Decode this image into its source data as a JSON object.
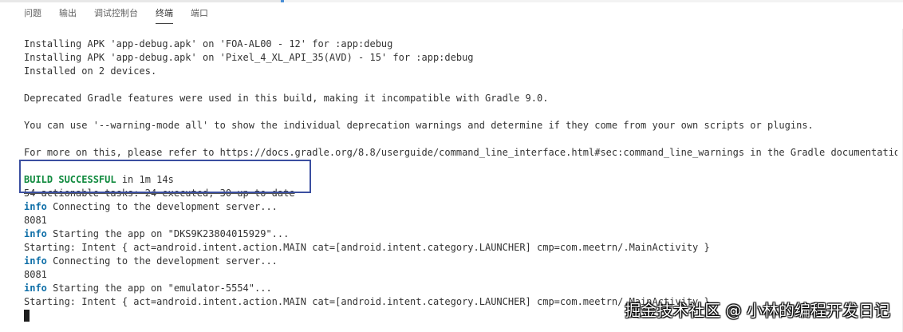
{
  "tabs": [
    {
      "label": "问题",
      "active": false
    },
    {
      "label": "输出",
      "active": false
    },
    {
      "label": "调试控制台",
      "active": false
    },
    {
      "label": "终端",
      "active": true
    },
    {
      "label": "端口",
      "active": false
    }
  ],
  "terminal": {
    "lines": [
      "Installing APK 'app-debug.apk' on 'FOA-AL00 - 12' for :app:debug",
      "Installing APK 'app-debug.apk' on 'Pixel_4_XL_API_35(AVD) - 15' for :app:debug",
      "Installed on 2 devices.",
      "",
      "Deprecated Gradle features were used in this build, making it incompatible with Gradle 9.0.",
      "",
      "You can use '--warning-mode all' to show the individual deprecation warnings and determine if they come from your own scripts or plugins.",
      "",
      "For more on this, please refer to https://docs.gradle.org/8.8/userguide/command_line_interface.html#sec:command_line_warnings in the Gradle documentation.",
      ""
    ],
    "build_status": "BUILD SUCCESSFUL",
    "build_time": " in 1m 14s",
    "tasks_line": "54 actionable tasks: 24 executed, 30 up-to-date",
    "info_tag": "info",
    "info_connecting": " Connecting to the development server...",
    "port": "8081",
    "info_starting_1": " Starting the app on \"DKS9K23804015929\"...",
    "intent_line_1": "Starting: Intent { act=android.intent.action.MAIN cat=[android.intent.category.LAUNCHER] cmp=com.meetrn/.MainActivity }",
    "info_starting_2": " Starting the app on \"emulator-5554\"...",
    "intent_line_2": "Starting: Intent { act=android.intent.action.MAIN cat=[android.intent.category.LAUNCHER] cmp=com.meetrn/.MainActivity }"
  },
  "watermark": "掘金技术社区 @ 小林的编程开发日记",
  "colors": {
    "success": "#108a3e",
    "info": "#0f6fa8",
    "highlight_box": "#3b4fa0"
  }
}
